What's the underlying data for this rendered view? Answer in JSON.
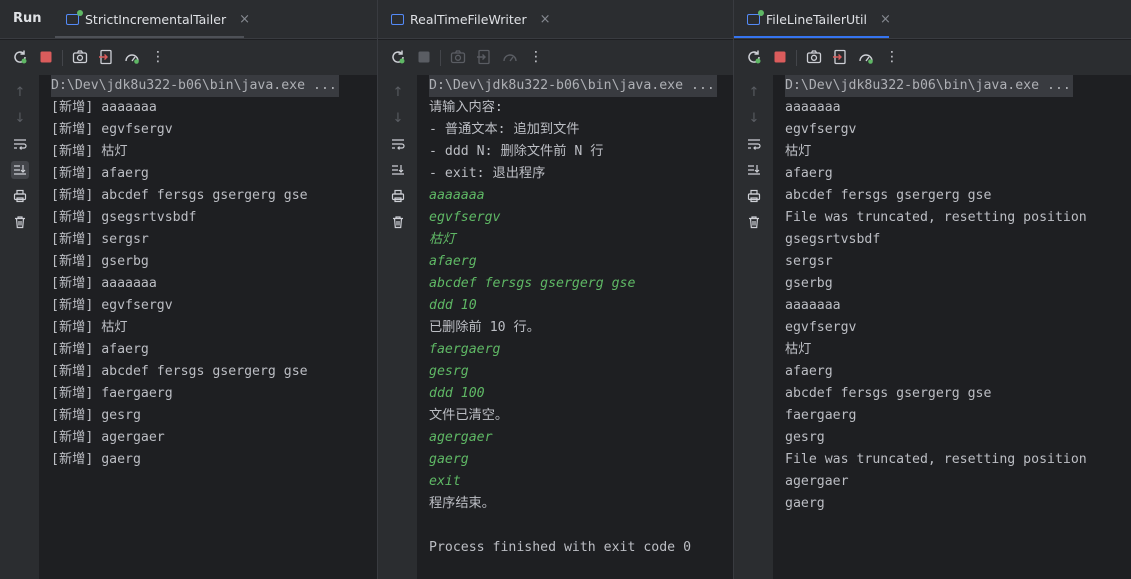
{
  "run_label": "Run",
  "panels": [
    {
      "tab": {
        "title": "StrictIncrementalTailer",
        "close": "×"
      },
      "command": "D:\\Dev\\jdk8u322-b06\\bin\\java.exe ...",
      "lines": [
        {
          "text": "[新增] aaaaaaa",
          "kind": "stdout"
        },
        {
          "text": "[新增] egvfsergv",
          "kind": "stdout"
        },
        {
          "text": "[新增] 枯灯",
          "kind": "stdout"
        },
        {
          "text": "[新增] afaerg",
          "kind": "stdout"
        },
        {
          "text": "[新增] abcdef fersgs gsergerg gse",
          "kind": "stdout"
        },
        {
          "text": "[新增] gsegsrtvsbdf",
          "kind": "stdout"
        },
        {
          "text": "[新增] sergsr",
          "kind": "stdout"
        },
        {
          "text": "[新增] gserbg",
          "kind": "stdout"
        },
        {
          "text": "[新增] aaaaaaa",
          "kind": "stdout"
        },
        {
          "text": "[新增] egvfsergv",
          "kind": "stdout"
        },
        {
          "text": "[新增] 枯灯",
          "kind": "stdout"
        },
        {
          "text": "[新增] afaerg",
          "kind": "stdout"
        },
        {
          "text": "[新增] abcdef fersgs gsergerg gse",
          "kind": "stdout"
        },
        {
          "text": "[新增] faergaerg",
          "kind": "stdout"
        },
        {
          "text": "[新增] gesrg",
          "kind": "stdout"
        },
        {
          "text": "[新增] agergaer",
          "kind": "stdout"
        },
        {
          "text": "[新增] gaerg",
          "kind": "stdout"
        }
      ]
    },
    {
      "tab": {
        "title": "RealTimeFileWriter",
        "close": "×"
      },
      "command": "D:\\Dev\\jdk8u322-b06\\bin\\java.exe ...",
      "lines": [
        {
          "text": "请输入内容:",
          "kind": "stdout"
        },
        {
          "text": "- 普通文本: 追加到文件",
          "kind": "stdout"
        },
        {
          "text": "- ddd N: 删除文件前 N 行",
          "kind": "stdout"
        },
        {
          "text": "- exit: 退出程序",
          "kind": "stdout"
        },
        {
          "text": "aaaaaaa",
          "kind": "input"
        },
        {
          "text": "egvfsergv",
          "kind": "input"
        },
        {
          "text": "枯灯",
          "kind": "input"
        },
        {
          "text": "afaerg",
          "kind": "input"
        },
        {
          "text": "abcdef fersgs gsergerg gse",
          "kind": "input"
        },
        {
          "text": "ddd 10",
          "kind": "input"
        },
        {
          "text": "已删除前 10 行。",
          "kind": "stdout"
        },
        {
          "text": "faergaerg",
          "kind": "input"
        },
        {
          "text": "gesrg",
          "kind": "input"
        },
        {
          "text": "ddd 100",
          "kind": "input"
        },
        {
          "text": "文件已清空。",
          "kind": "stdout"
        },
        {
          "text": "agergaer",
          "kind": "input"
        },
        {
          "text": "gaerg",
          "kind": "input"
        },
        {
          "text": "exit",
          "kind": "input"
        },
        {
          "text": "程序结束。",
          "kind": "stdout"
        },
        {
          "text": "",
          "kind": "stdout"
        },
        {
          "text": "Process finished with exit code 0",
          "kind": "stdout"
        }
      ]
    },
    {
      "tab": {
        "title": "FileLineTailerUtil",
        "close": "×"
      },
      "command": "D:\\Dev\\jdk8u322-b06\\bin\\java.exe ...",
      "lines": [
        {
          "text": "aaaaaaa",
          "kind": "stdout"
        },
        {
          "text": "egvfsergv",
          "kind": "stdout"
        },
        {
          "text": "枯灯",
          "kind": "stdout"
        },
        {
          "text": "afaerg",
          "kind": "stdout"
        },
        {
          "text": "abcdef fersgs gsergerg gse",
          "kind": "stdout"
        },
        {
          "text": "File was truncated, resetting position",
          "kind": "stdout"
        },
        {
          "text": "gsegsrtvsbdf",
          "kind": "stdout"
        },
        {
          "text": "sergsr",
          "kind": "stdout"
        },
        {
          "text": "gserbg",
          "kind": "stdout"
        },
        {
          "text": "aaaaaaa",
          "kind": "stdout"
        },
        {
          "text": "egvfsergv",
          "kind": "stdout"
        },
        {
          "text": "枯灯",
          "kind": "stdout"
        },
        {
          "text": "afaerg",
          "kind": "stdout"
        },
        {
          "text": "abcdef fersgs gsergerg gse",
          "kind": "stdout"
        },
        {
          "text": "faergaerg",
          "kind": "stdout"
        },
        {
          "text": "gesrg",
          "kind": "stdout"
        },
        {
          "text": "File was truncated, resetting position",
          "kind": "stdout"
        },
        {
          "text": "agergaer",
          "kind": "stdout"
        },
        {
          "text": "gaerg",
          "kind": "stdout"
        }
      ]
    }
  ],
  "toolbar_icons": [
    "rerun-icon",
    "stop-icon",
    "screenshot-icon",
    "export-icon",
    "profiler-icon",
    "more-options-icon"
  ],
  "gutter_icons": [
    "scroll-up-icon",
    "scroll-down-icon",
    "soft-wrap-icon",
    "scroll-to-end-icon",
    "print-icon",
    "clear-all-icon"
  ],
  "colors": {
    "background": "#1e1f22",
    "chrome": "#2b2d30",
    "input_text": "#5fb865",
    "stdout_text": "#bcbec4",
    "stop_active": "#db5c5c",
    "stop_inactive": "#5a5d63",
    "accent_underline": "#3574f0",
    "inactive_underline": "#4e5157"
  }
}
